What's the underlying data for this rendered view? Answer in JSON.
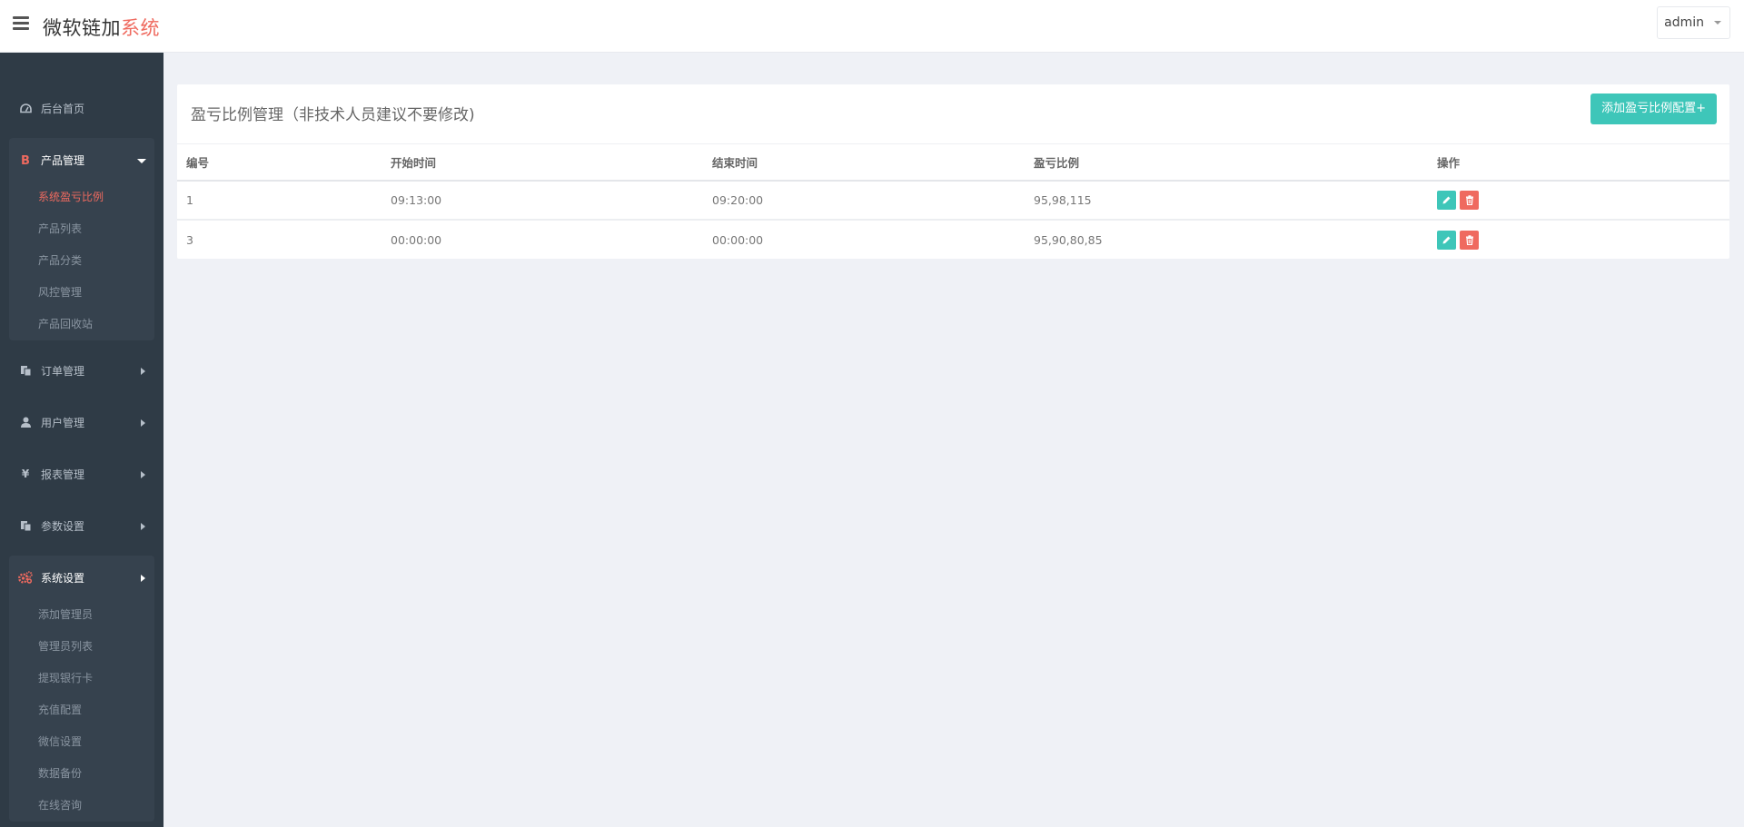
{
  "header": {
    "brand_main": "微软链加",
    "brand_accent": "系统",
    "user_label": "admin"
  },
  "sidebar": {
    "items": [
      {
        "label": "后台首页",
        "icon": "dashboard-icon"
      },
      {
        "label": "产品管理",
        "icon": "bitcoin-icon",
        "open": true,
        "children": [
          "系统盈亏比例",
          "产品列表",
          "产品分类",
          "风控管理",
          "产品回收站"
        ],
        "active_child": "系统盈亏比例"
      },
      {
        "label": "订单管理",
        "icon": "copy-icon"
      },
      {
        "label": "用户管理",
        "icon": "user-icon"
      },
      {
        "label": "报表管理",
        "icon": "yen-icon"
      },
      {
        "label": "参数设置",
        "icon": "copy-icon"
      },
      {
        "label": "系统设置",
        "icon": "gears-icon",
        "open": true,
        "children": [
          "添加管理员",
          "管理员列表",
          "提现银行卡",
          "充值配置",
          "微信设置",
          "数据备份",
          "在线咨询"
        ]
      }
    ]
  },
  "main": {
    "title": "盈亏比例管理（非技术人员建议不要修改)",
    "add_button": "添加盈亏比例配置+",
    "table": {
      "headers": [
        "编号",
        "开始时间",
        "结束时间",
        "盈亏比例",
        "操作"
      ],
      "rows": [
        [
          "1",
          "09:13:00",
          "09:20:00",
          "95,98,115"
        ],
        [
          "3",
          "00:00:00",
          "00:00:00",
          "95,90,80,85"
        ]
      ]
    }
  },
  "colors": {
    "accent_red": "#ef6a5f",
    "accent_teal": "#3ec6b9",
    "sidebar_bg": "#2f3b46"
  }
}
